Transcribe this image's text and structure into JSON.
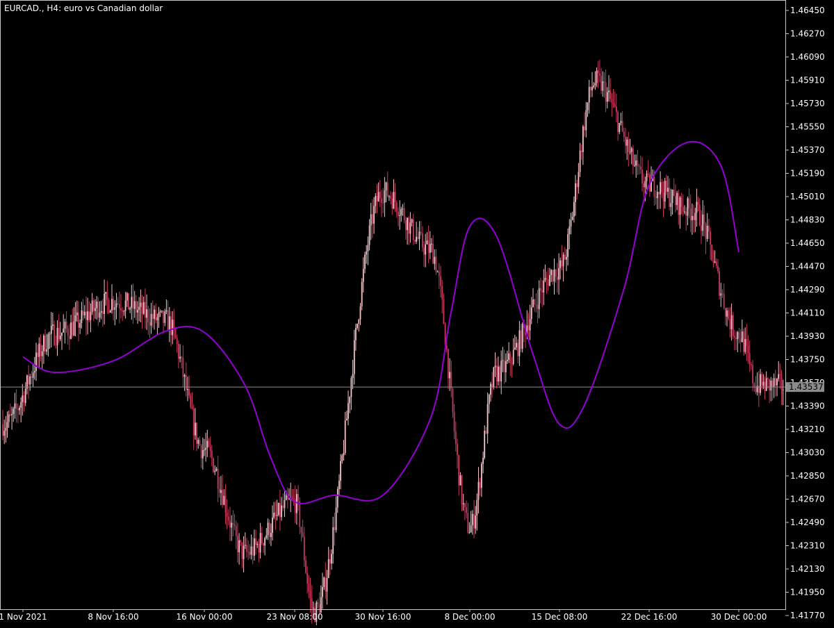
{
  "header": {
    "symbol": "EURCAD.",
    "timeframe": "H4",
    "description": "euro vs Canadian dollar"
  },
  "current_price_label": "1.43537",
  "colors": {
    "background": "#000000",
    "frame": "#c8c8c8",
    "text": "#ffffff",
    "bull_candle": "#f5c4c8",
    "bear_candle": "#c8385e",
    "indicator_line": "#9400d3",
    "price_line": "#8c8c8c",
    "price_label_bg": "#8c8c8c"
  },
  "chart_data": {
    "type": "line",
    "title": "",
    "xlabel": "",
    "ylabel": "",
    "ylim": [
      1.4165,
      1.4652
    ],
    "grid": false,
    "y_ticks": [
      "1.46450",
      "1.46270",
      "1.46090",
      "1.45910",
      "1.45730",
      "1.45550",
      "1.45370",
      "1.45190",
      "1.45010",
      "1.44830",
      "1.44650",
      "1.44470",
      "1.44290",
      "1.44110",
      "1.43930",
      "1.43750",
      "1.43570",
      "1.43390",
      "1.43210",
      "1.43030",
      "1.42850",
      "1.42670",
      "1.42490",
      "1.42310",
      "1.42130",
      "1.41950",
      "1.41770"
    ],
    "x_ticks": [
      "1 Nov 2021",
      "8 Nov 16:00",
      "16 Nov 00:00",
      "23 Nov 08:00",
      "30 Nov 16:00",
      "8 Dec 00:00",
      "15 Dec 08:00",
      "22 Dec 16:00",
      "30 Dec 00:00"
    ],
    "current_price": 1.43537,
    "candlesticks": {
      "description": "EURCAD H4 price candles (approximate closes along time axis)",
      "x": [
        "1 Nov 2021",
        "4 Nov 2021",
        "8 Nov 16:00",
        "12 Nov 2021",
        "16 Nov 00:00",
        "19 Nov 2021",
        "23 Nov 08:00",
        "25 Nov 2021",
        "30 Nov 16:00",
        "4 Dec 2021",
        "8 Dec 00:00",
        "10 Dec 2021",
        "15 Dec 08:00",
        "18 Dec 2021",
        "22 Dec 16:00",
        "26 Dec 2021",
        "30 Dec 00:00",
        "31 Dec 2021"
      ],
      "close": [
        1.4325,
        1.4395,
        1.442,
        1.4405,
        1.4305,
        1.4225,
        1.4265,
        1.418,
        1.4505,
        1.446,
        1.4245,
        1.4365,
        1.4445,
        1.459,
        1.451,
        1.449,
        1.4395,
        1.4355
      ]
    },
    "series": [
      {
        "x": [
          "1 Nov 2021",
          "4 Nov 2021",
          "8 Nov 16:00",
          "12 Nov 2021",
          "16 Nov 00:00",
          "19 Nov 2021",
          "21 Nov 2021",
          "23 Nov 08:00",
          "26 Nov 2021",
          "30 Nov 16:00",
          "4 Dec 2021",
          "6 Dec 2021",
          "8 Dec 00:00",
          "10 Dec 2021",
          "13 Dec 2021",
          "15 Dec 08:00",
          "17 Dec 2021",
          "20 Dec 2021",
          "22 Dec 16:00",
          "25 Dec 2021",
          "28 Dec 2021",
          "31 Dec 2021"
        ],
        "values": [
          1.4377,
          1.4365,
          1.4374,
          1.4397,
          1.4396,
          1.4355,
          1.43,
          1.4265,
          1.427,
          1.427,
          1.433,
          1.441,
          1.4478,
          1.447,
          1.438,
          1.4325,
          1.434,
          1.443,
          1.451,
          1.4543,
          1.4525,
          1.4458
        ]
      }
    ]
  }
}
